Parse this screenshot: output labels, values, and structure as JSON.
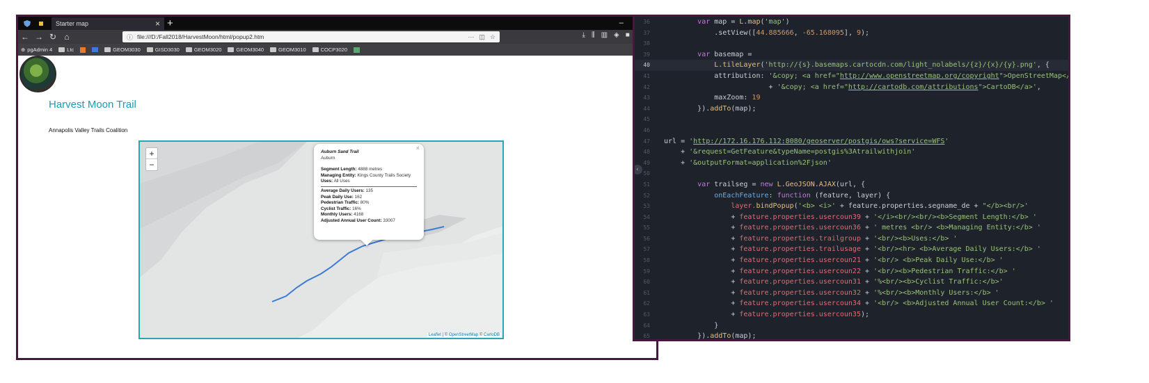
{
  "browser": {
    "tab_title": "Starter map",
    "tab_close": "×",
    "new_tab": "+",
    "win_minimize": "–",
    "win_restore": "▫",
    "win_close": "✕",
    "url": "file:///D:/Fall2018/HarvestMoon/html/popup2.htm",
    "url_more": "···",
    "bookmarks": [
      "pgAdmin 4",
      "Ltc",
      "GEOM3030",
      "GISD3030",
      "GEOM3020",
      "GEOM3040",
      "GEOM3010",
      "COCP3020"
    ]
  },
  "page": {
    "title": "Harvest Moon Trail",
    "subtitle": "Annapolis Valley Trails Coalition"
  },
  "map": {
    "zoom_in": "+",
    "zoom_out": "−",
    "popup": {
      "close": "×",
      "segment_name": "Auburn Sand Trail",
      "uses_place": "Auburn",
      "segment_length_label": "Segment Length:",
      "segment_length_value": "4888 metres",
      "managing_entity_label": "Managing Entity:",
      "managing_entity_value": "Kings County Trails Society",
      "uses_label": "Uses:",
      "uses_value": "All Uses",
      "avg_daily_label": "Average Daily Users:",
      "avg_daily_value": "135",
      "peak_daily_label": "Peak Daily Use:",
      "peak_daily_value": "162",
      "pedestrian_label": "Pedestrian Traffic:",
      "pedestrian_value": "80%",
      "cyclist_label": "Cyclist Traffic:",
      "cyclist_value": "16%",
      "monthly_label": "Monthly Users:",
      "monthly_value": "4168",
      "annual_label": "Adjusted Annual User Count:",
      "annual_value": "33007"
    },
    "attribution_leaflet": "Leaflet",
    "attribution_osm": "OpenStreetMap",
    "attribution_carto": "CartoDB",
    "trail_color": "#3a7bd5"
  },
  "editor": {
    "line_numbers": [
      "36",
      "37",
      "38",
      "39",
      "40",
      "41",
      "42",
      "43",
      "44",
      "45",
      "46",
      "47",
      "48",
      "49",
      "50",
      "51",
      "52",
      "53",
      "54",
      "55",
      "56",
      "57",
      "58",
      "59",
      "60",
      "61",
      "62",
      "63",
      "64",
      "65"
    ],
    "current_line": "40",
    "l36": {
      "kw": "var",
      "a": " map = ",
      "fn": "L.map",
      "b": "(",
      "s": "'map'",
      "c": ")"
    },
    "l37": {
      "a": ".setView([",
      "n1": "44.885666",
      "b": ", ",
      "n2": "-65.168095",
      "c": "], ",
      "n3": "9",
      "d": ");"
    },
    "l39": {
      "kw": "var",
      "a": " basemap ="
    },
    "l40": {
      "fn": "L.tileLayer",
      "a": "(",
      "s": "'http://{s}.basemaps.cartocdn.com/light_nolabels/{z}/{x}/{y}.png'",
      "b": ", {"
    },
    "l41": {
      "a": "attribution: ",
      "s1": "'&copy; <a href=\"",
      "u": "http://www.openstreetmap.org/copyright",
      "s2": "\">OpenStreetMap</a>'"
    },
    "l42": {
      "a": "+ ",
      "s1": "'&copy; <a href=\"",
      "u": "http://cartodb.com/attributions",
      "s2": "\">CartoDB</a>'",
      "b": ","
    },
    "l43": {
      "a": "maxZoom: ",
      "n": "19"
    },
    "l44": {
      "a": "}).",
      "fn": "addTo",
      "b": "(map);"
    },
    "l47": {
      "a": "url = ",
      "s1": "'",
      "u": "http://172.16.176.112:8080/geoserver/postgis/ows?service=WFS",
      "s2": "'"
    },
    "l48": {
      "a": "+ ",
      "s": "'&request=GetFeature&typeName=postgis%3Atrailwithjoin'"
    },
    "l49": {
      "a": "+ ",
      "s": "'&outputFormat=application%2Fjson'"
    },
    "l51": {
      "kw": "var",
      "a": " trailseg = ",
      "kw2": "new",
      "fn": " L.GeoJSON.AJAX",
      "b": "(url, {"
    },
    "l52": {
      "fn": "onEachFeature",
      "a": ": ",
      "kw": "function",
      "b": " (feature, layer) {"
    },
    "l53": {
      "a": "layer.",
      "fn": "bindPopup",
      "b": "(",
      "s1": "'<b> <i>'",
      "c": " + ",
      "p": "feature.properties.segname_de",
      "d": " + ",
      "s2": "\"</b><br/>'"
    },
    "l54": {
      "a": "+ ",
      "p": "feature.properties.usercoun39",
      "b": " + ",
      "s": "'</i><br/><br/><b>Segment Length:</b> '"
    },
    "l55": {
      "a": "+ ",
      "p": "feature.properties.usercoun36",
      "b": " + ",
      "s": "' metres <br/> <b>Managing Entity:</b> '"
    },
    "l56": {
      "a": "+ ",
      "p": "feature.properties.trailgroup",
      "b": " + ",
      "s": "'<br/><b>Uses:</b> '"
    },
    "l57": {
      "a": "+ ",
      "p": "feature.properties.trailusage",
      "b": " + ",
      "s": "'<br/><hr> <b>Average Daily Users:</b> '"
    },
    "l58": {
      "a": "+ ",
      "p": "feature.properties.usercoun21",
      "b": " + ",
      "s": "'<br/> <b>Peak Daily Use:</b> '"
    },
    "l59": {
      "a": "+ ",
      "p": "feature.properties.usercoun22",
      "b": " + ",
      "s": "'<br/><b>Pedestrian Traffic:</b> '"
    },
    "l60": {
      "a": "+ ",
      "p": "feature.properties.usercoun31",
      "b": " + ",
      "s": "'%<br/><b>Cyclist Traffic:</b>'"
    },
    "l61": {
      "a": "+ ",
      "p": "feature.properties.usercoun32",
      "b": " + ",
      "s": "'%<br/><b>Monthly Users:</b> '"
    },
    "l62": {
      "a": "+ ",
      "p": "feature.properties.usercoun34",
      "b": " + ",
      "s": "'<br/> <b>Adjusted Annual User Count:</b> '"
    },
    "l63": {
      "a": "+ ",
      "p": "feature.properties.usercoun35",
      "b": ");"
    },
    "l64": {
      "a": "}"
    },
    "l65": {
      "a": "}).",
      "fn": "addTo",
      "b": "(map);"
    },
    "collapse": "‹"
  }
}
